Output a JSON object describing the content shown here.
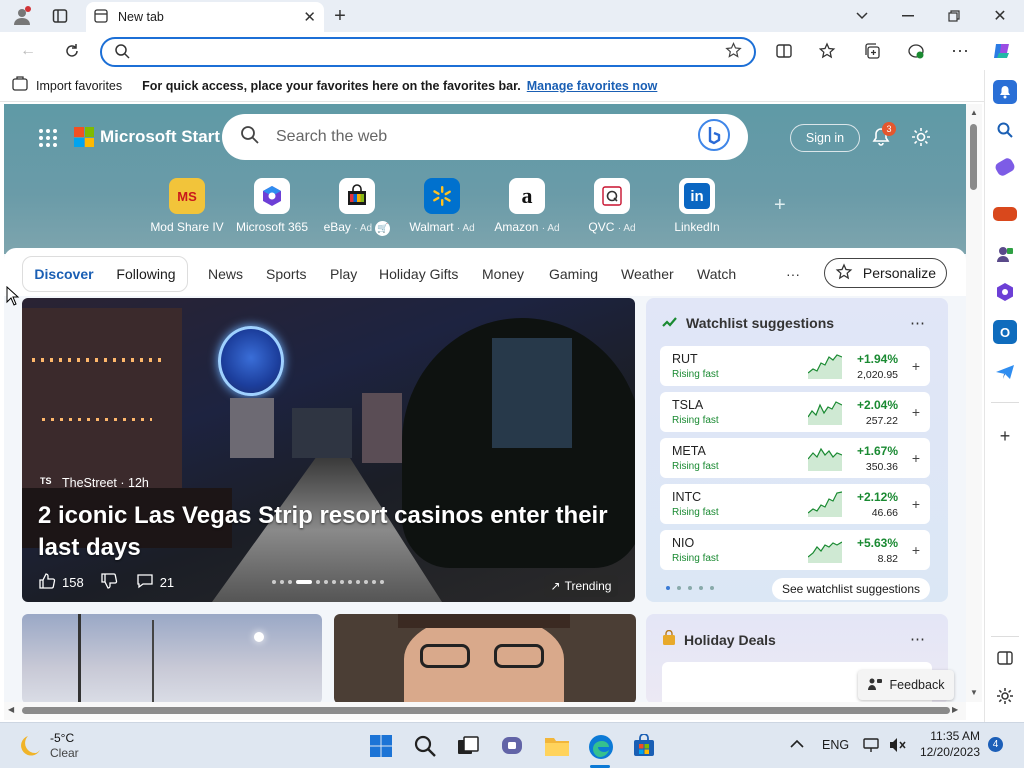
{
  "browser": {
    "tab_title": "New tab",
    "address_placeholder": "",
    "favorites_import": "Import favorites",
    "favorites_message": "For quick access, place your favorites here on the favorites bar.",
    "favorites_link": "Manage favorites now"
  },
  "header": {
    "brand": "Microsoft Start",
    "search_placeholder": "Search the web",
    "sign_in": "Sign in",
    "notification_count": "3"
  },
  "quick_links": [
    {
      "label": "Mod Share IV",
      "ad": ""
    },
    {
      "label": "Microsoft 365",
      "ad": ""
    },
    {
      "label": "eBay",
      "ad": "· Ad"
    },
    {
      "label": "Walmart",
      "ad": "· Ad"
    },
    {
      "label": "Amazon",
      "ad": "· Ad"
    },
    {
      "label": "QVC",
      "ad": "· Ad"
    },
    {
      "label": "LinkedIn",
      "ad": ""
    }
  ],
  "nav": {
    "discover": "Discover",
    "following": "Following",
    "items": [
      "News",
      "Sports",
      "Play",
      "Holiday Gifts",
      "Money",
      "Gaming",
      "Weather",
      "Watch"
    ],
    "more": "···",
    "personalize": "Personalize"
  },
  "main_story": {
    "source": "TheStreet · 12h",
    "source_logo": "TS",
    "headline": "2 iconic Las Vegas Strip resort casinos enter their last days",
    "likes": "158",
    "comments": "21",
    "badge": "Trending"
  },
  "watchlist": {
    "title": "Watchlist suggestions",
    "stocks": [
      {
        "symbol": "RUT",
        "status": "Rising fast",
        "change": "+1.94%",
        "price": "2,020.95"
      },
      {
        "symbol": "TSLA",
        "status": "Rising fast",
        "change": "+2.04%",
        "price": "257.22"
      },
      {
        "symbol": "META",
        "status": "Rising fast",
        "change": "+1.67%",
        "price": "350.36"
      },
      {
        "symbol": "INTC",
        "status": "Rising fast",
        "change": "+2.12%",
        "price": "46.66"
      },
      {
        "symbol": "NIO",
        "status": "Rising fast",
        "change": "+5.63%",
        "price": "8.82"
      }
    ],
    "see_more": "See watchlist suggestions"
  },
  "holiday": {
    "title": "Holiday Deals"
  },
  "feedback": "Feedback",
  "taskbar": {
    "temp": "-5°C",
    "condition": "Clear",
    "lang": "ENG",
    "time": "11:35 AM",
    "date": "12/20/2023",
    "notif": "4"
  },
  "colors": {
    "accent": "#1c6fd6",
    "positive": "#1a8a32",
    "hero": "#6a9ba8"
  }
}
